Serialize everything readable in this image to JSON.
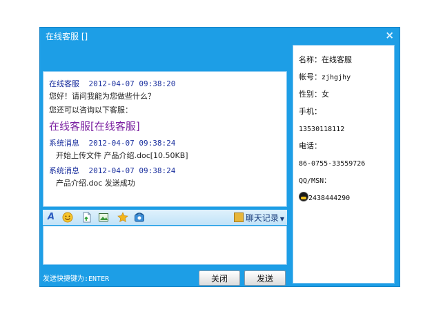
{
  "window": {
    "title": "在线客服 []",
    "close_glyph": "×"
  },
  "chat": {
    "messages": [
      {
        "sender": "在线客服",
        "time": "2012-04-07 09:38:20",
        "lines": [
          "您好！请问我能为您做些什么？",
          "您还可以咨询以下客服："
        ],
        "link": "在线客服[在线客服]"
      },
      {
        "sender": "系统消息",
        "time": "2012-04-07 09:38:24",
        "lines": [
          "开始上传文件 产品介绍.doc[10.50KB]"
        ]
      },
      {
        "sender": "系统消息",
        "time": "2012-04-07 09:38:24",
        "lines": [
          "产品介绍.doc 发送成功"
        ]
      }
    ]
  },
  "toolbar": {
    "icons": [
      "font-icon",
      "emoji-icon",
      "send-file-icon",
      "screenshot-icon",
      "favorite-icon",
      "phone-icon"
    ],
    "history_label": "聊天记录"
  },
  "input": {
    "value": "",
    "placeholder": ""
  },
  "footer": {
    "shortcut_text": "发送快捷键为:ENTER",
    "close_label": "关闭",
    "send_label": "发送"
  },
  "info": {
    "name_label": "名称：",
    "name_value": "在线客服",
    "account_label": "帐号：",
    "account_value": "zjhgjhy",
    "gender_label": "性别：",
    "gender_value": "女",
    "mobile_label": "手机：",
    "mobile_value": "13530118112",
    "phone_label": "电话：",
    "phone_value": "86-0755-33559726",
    "qq_label": "QQ/MSN：",
    "qq_value": "2438444290"
  },
  "colors": {
    "window_blue": "#1d9ee6",
    "sender_blue": "#1a2f9e",
    "link_purple": "#7a1fa0"
  }
}
